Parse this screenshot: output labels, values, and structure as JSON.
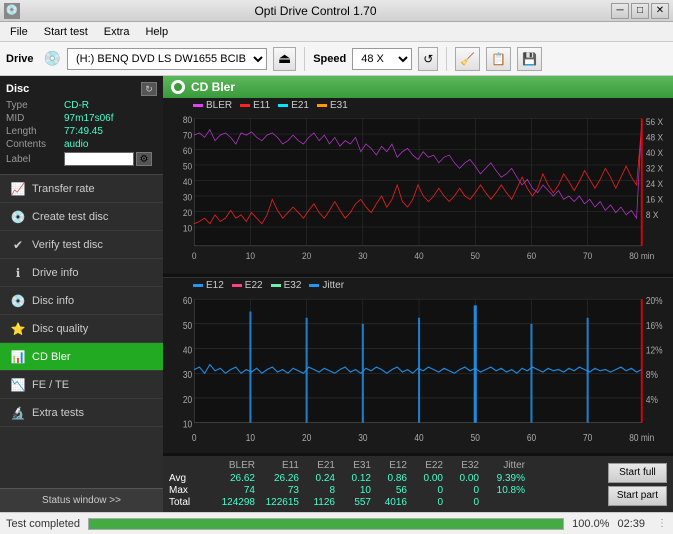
{
  "titlebar": {
    "title": "Opti Drive Control 1.70",
    "icon": "💿",
    "minimize": "─",
    "maximize": "□",
    "close": "✕"
  },
  "menubar": {
    "items": [
      "File",
      "Start test",
      "Extra",
      "Help"
    ]
  },
  "toolbar": {
    "drive_label": "Drive",
    "drive_icon": "💿",
    "drive_value": "(H:)  BENQ DVD LS DW1655 BCIB",
    "eject_icon": "⏏",
    "speed_label": "Speed",
    "speed_value": "48 X",
    "refresh_icon": "↺",
    "clear_icon": "🧹",
    "copy_icon": "📋",
    "save_icon": "💾"
  },
  "disc": {
    "title": "Disc",
    "type_label": "Type",
    "type_value": "CD-R",
    "mid_label": "MID",
    "mid_value": "97m17s06f",
    "length_label": "Length",
    "length_value": "77:49.45",
    "contents_label": "Contents",
    "contents_value": "audio",
    "label_label": "Label",
    "label_placeholder": ""
  },
  "sidebar": {
    "items": [
      {
        "id": "transfer-rate",
        "icon": "📈",
        "label": "Transfer rate"
      },
      {
        "id": "create-test-disc",
        "icon": "💿",
        "label": "Create test disc"
      },
      {
        "id": "verify-test-disc",
        "icon": "✔",
        "label": "Verify test disc"
      },
      {
        "id": "drive-info",
        "icon": "ℹ",
        "label": "Drive info"
      },
      {
        "id": "disc-info",
        "icon": "💿",
        "label": "Disc info"
      },
      {
        "id": "disc-quality",
        "icon": "⭐",
        "label": "Disc quality"
      },
      {
        "id": "cd-bler",
        "icon": "📊",
        "label": "CD Bler",
        "active": true,
        "highlight": true
      },
      {
        "id": "fe-te",
        "icon": "📉",
        "label": "FE / TE"
      },
      {
        "id": "extra-tests",
        "icon": "🔬",
        "label": "Extra tests"
      }
    ],
    "status_window": "Status window >>"
  },
  "chart": {
    "title": "CD Bler",
    "upper_legend": [
      {
        "key": "BLER",
        "color": "#e040fb"
      },
      {
        "key": "E11",
        "color": "#ff2020"
      },
      {
        "key": "E21",
        "color": "#00e5ff"
      },
      {
        "key": "E31",
        "color": "#ff9900"
      }
    ],
    "lower_legend": [
      {
        "key": "E12",
        "color": "#2196f3"
      },
      {
        "key": "E22",
        "color": "#ff4081"
      },
      {
        "key": "E32",
        "color": "#69f0ae"
      },
      {
        "key": "Jitter",
        "color": "#2196f3"
      }
    ],
    "upper_y_labels": [
      "80",
      "70",
      "60",
      "50",
      "40",
      "30",
      "20",
      "10"
    ],
    "upper_y_right": [
      "56 X",
      "48 X",
      "40 X",
      "32 X",
      "24 X",
      "16 X",
      "8 X"
    ],
    "lower_y_labels": [
      "60",
      "50",
      "40",
      "30",
      "20",
      "10"
    ],
    "lower_y_right": [
      "20%",
      "16%",
      "12%",
      "8%",
      "4%"
    ],
    "x_labels": [
      "0",
      "10",
      "20",
      "30",
      "40",
      "50",
      "60",
      "70",
      "80 min"
    ]
  },
  "stats": {
    "headers": [
      "",
      "BLER",
      "E11",
      "E21",
      "E31",
      "E12",
      "E22",
      "E32",
      "Jitter"
    ],
    "rows": [
      {
        "label": "Avg",
        "values": [
          "26.62",
          "26.26",
          "0.24",
          "0.12",
          "0.86",
          "0.00",
          "0.00",
          "9.39%"
        ]
      },
      {
        "label": "Max",
        "values": [
          "74",
          "73",
          "8",
          "10",
          "56",
          "0",
          "0",
          "10.8%"
        ]
      },
      {
        "label": "Total",
        "values": [
          "124298",
          "122615",
          "1126",
          "557",
          "4016",
          "0",
          "0",
          ""
        ]
      }
    ],
    "start_full_label": "Start full",
    "start_part_label": "Start part"
  },
  "statusbar": {
    "status_text": "Test completed",
    "progress_percent": "100.0%",
    "progress_value": 100,
    "time": "02:39"
  }
}
